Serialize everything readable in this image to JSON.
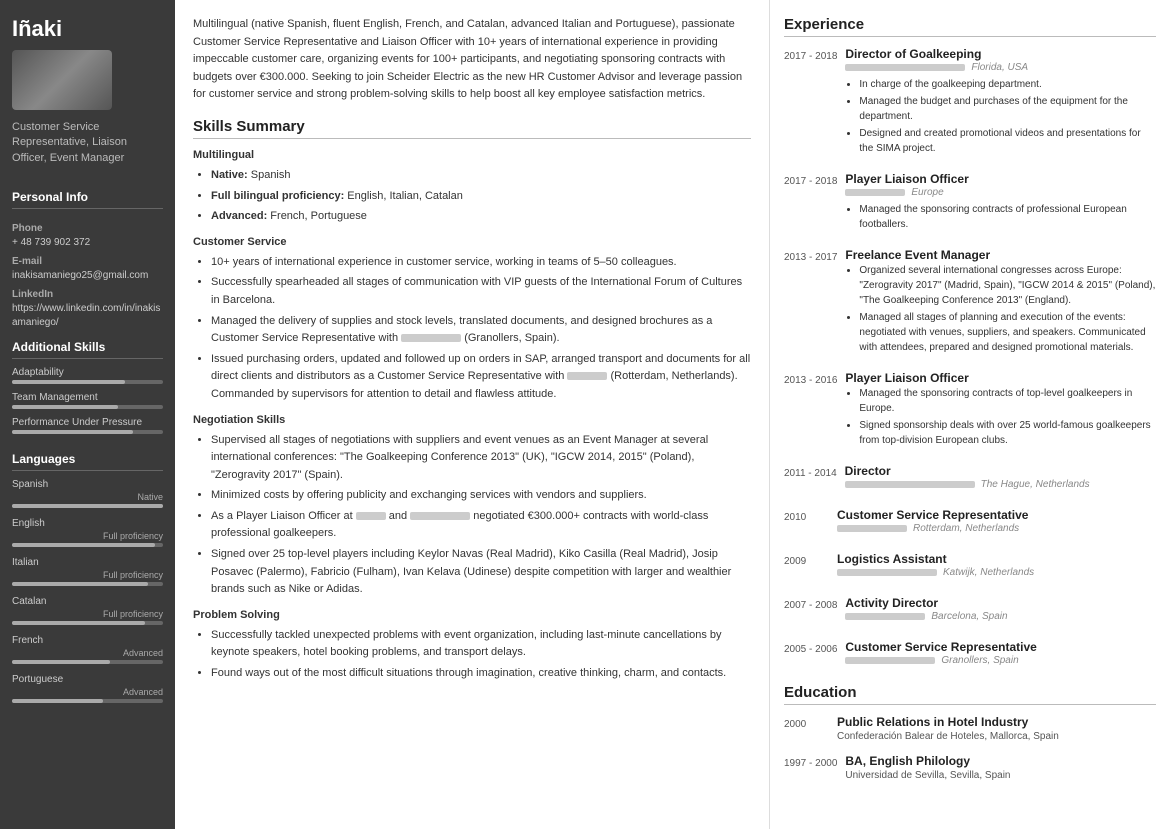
{
  "sidebar": {
    "name": "Iñaki",
    "title": "Customer Service Representative, Liaison Officer, Event Manager",
    "personal_section": "Personal Info",
    "phone_label": "Phone",
    "phone_value": "+ 48 739 902 372",
    "email_label": "E-mail",
    "email_value": "inakisamaniego25@gmail.com",
    "linkedin_label": "LinkedIn",
    "linkedin_value": "https://www.linkedin.com/in/inakisamaniego/",
    "skills_section": "Additional Skills",
    "skills": [
      {
        "name": "Adaptability",
        "pct": 75
      },
      {
        "name": "Team Management",
        "pct": 70
      },
      {
        "name": "Performance Under Pressure",
        "pct": 80
      }
    ],
    "languages_section": "Languages",
    "languages": [
      {
        "name": "Spanish",
        "level": "Native",
        "pct": 100
      },
      {
        "name": "English",
        "level": "Full proficiency",
        "pct": 95
      },
      {
        "name": "Italian",
        "level": "Full proficiency",
        "pct": 90
      },
      {
        "name": "Catalan",
        "level": "Full proficiency",
        "pct": 88
      },
      {
        "name": "French",
        "level": "Advanced",
        "pct": 65
      },
      {
        "name": "Portuguese",
        "level": "Advanced",
        "pct": 60
      }
    ]
  },
  "summary": "Multilingual (native Spanish, fluent English, French, and Catalan, advanced Italian and Portuguese), passionate Customer Service Representative and Liaison Officer with 10+ years of international experience in providing impeccable customer care, organizing events for 100+ participants, and negotiating sponsoring contracts with budgets over €300.000. Seeking to join Scheider Electric as the new HR Customer Advisor and leverage passion for customer service and strong problem-solving skills to help boost all key employee satisfaction metrics.",
  "skills_summary_title": "Skills Summary",
  "multilingual_title": "Multilingual",
  "multilingual_bullets": [
    {
      "label": "Native:",
      "text": " Spanish"
    },
    {
      "label": "Full bilingual proficiency:",
      "text": " English, Italian, Catalan"
    },
    {
      "label": "Advanced:",
      "text": " French, Portuguese"
    }
  ],
  "customer_service_title": "Customer Service",
  "customer_service_bullets": [
    "10+ years of international experience in customer service, working in teams of 5–50 colleagues.",
    "Successfully spearheaded all stages of communication with VIP guests of the International Forum of Cultures in Barcelona.",
    "Managed the delivery of supplies and stock levels, translated documents, and designed brochures as a Customer Service Representative with [REDACTED_60] (Granollers, Spain).",
    "Issued purchasing orders, updated and followed up on orders in SAP, arranged transport and documents for all direct clients and distributors as a Customer Service Representative with [REDACTED_40] (Rotterdam, Netherlands). Commanded by supervisors for attention to detail and flawless attitude."
  ],
  "negotiation_title": "Negotiation Skills",
  "negotiation_bullets": [
    "Supervised all stages of negotiations with suppliers and event venues as an Event Manager at several international conferences: \"The Goalkeeping Conference 2013\" (UK), \"IGCW 2014, 2015\" (Poland), \"Zerogravity 2017\" (Spain).",
    "Minimized costs by offering publicity and exchanging services with vendors and suppliers.",
    "As a Player Liaison Officer at [REDACTED_30] and [REDACTED_60] negotiated €300.000+ contracts with world-class professional goalkeepers.",
    "Signed over 25 top-level players including Keylor Navas (Real Madrid), Kiko Casilla (Real Madrid), Josip Posavec (Palermo), Fabricio (Fulham), Ivan Kelava (Udinese) despite competition with larger and wealthier brands such as Nike or Adidas."
  ],
  "problem_solving_title": "Problem Solving",
  "problem_solving_bullets": [
    "Successfully tackled unexpected problems with event organization, including last-minute cancellations by keynote speakers, hotel booking problems, and transport delays.",
    "Found ways out of the most difficult situations through imagination, creative thinking, charm, and contacts."
  ],
  "experience_title": "Experience",
  "experience": [
    {
      "years": "2017 -\n2018",
      "title": "Director of Goalkeeping",
      "company_width": 120,
      "location": "Florida, USA",
      "bullets": [
        "In charge of the goalkeeping department.",
        "Managed the budget and purchases of the equipment for the department.",
        "Designed and created promotional videos and presentations for the SIMA project."
      ]
    },
    {
      "years": "2017 -\n2018",
      "title": "Player Liaison Officer",
      "company_width": 60,
      "location": "Europe",
      "bullets": [
        "Managed the sponsoring contracts of professional European footballers."
      ]
    },
    {
      "years": "2013 -\n2017",
      "title": "Freelance Event Manager",
      "company_width": 0,
      "location": "",
      "bullets": [
        "Organized several international congresses across Europe: \"Zerogravity 2017\" (Madrid, Spain), \"IGCW 2014 & 2015\" (Poland), \"The Goalkeeping Conference 2013\" (England).",
        "Managed all stages of planning and execution of the events: negotiated with venues, suppliers, and speakers. Communicated with attendees, prepared and designed promotional materials."
      ]
    },
    {
      "years": "2013 -\n2016",
      "title": "Player Liaison Officer",
      "company_width": 0,
      "location": "",
      "bullets": [
        "Managed the sponsoring contracts of top-level goalkeepers in Europe.",
        "Signed sponsorship deals with over 25 world-famous goalkeepers from top-division European clubs."
      ]
    },
    {
      "years": "2011 -\n2014",
      "title": "Director",
      "company_width": 130,
      "location": "The Hague, Netherlands",
      "bullets": []
    },
    {
      "years": "2010",
      "title": "Customer Service Representative",
      "company_width": 70,
      "location": "Rotterdam, Netherlands",
      "bullets": []
    },
    {
      "years": "2009",
      "title": "Logistics Assistant",
      "company_width": 100,
      "location": "Katwijk, Netherlands",
      "bullets": []
    },
    {
      "years": "2007 -\n2008",
      "title": "Activity Director",
      "company_width": 80,
      "location": "Barcelona, Spain",
      "bullets": []
    },
    {
      "years": "2005 -\n2006",
      "title": "Customer Service Representative",
      "company_width": 90,
      "location": "Granollers, Spain",
      "bullets": []
    }
  ],
  "education_title": "Education",
  "education": [
    {
      "years": "2000",
      "degree": "Public Relations in Hotel Industry",
      "school": "Confederación Balear de Hoteles, Mallorca, Spain"
    },
    {
      "years": "1997 -\n2000",
      "degree": "BA, English Philology",
      "school": "Universidad de Sevilla, Sevilla, Spain"
    }
  ]
}
